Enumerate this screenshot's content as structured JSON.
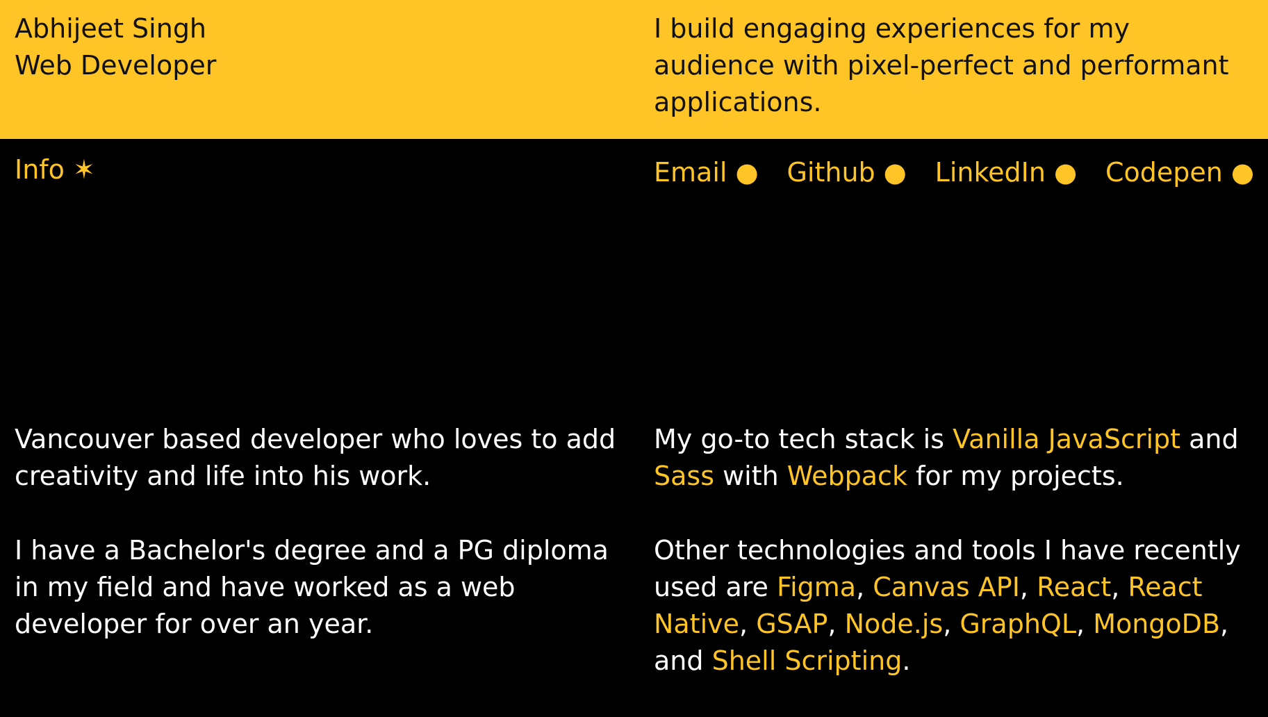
{
  "colors": {
    "accent": "#ffc425",
    "background": "#000000",
    "header_text": "#111111",
    "text": "#ffffff"
  },
  "header": {
    "name": "Abhijeet Singh",
    "role": "Web Developer",
    "tagline": "I build engaging experiences for my audience with pixel-perfect and performant applications."
  },
  "info": {
    "label": "Info",
    "icon": "six-pointed-star-icon",
    "glyph": "✶"
  },
  "social": [
    {
      "label": "Email",
      "bullet": "●"
    },
    {
      "label": "Github",
      "bullet": "●"
    },
    {
      "label": "LinkedIn",
      "bullet": "●"
    },
    {
      "label": "Codepen",
      "bullet": "●"
    }
  ],
  "about": {
    "p1": "Vancouver based developer who loves to add creativity and life into his work.",
    "p2": "I have a Bachelor's degree and a PG diploma in my field and have worked as a web developer for over an year."
  },
  "stack": {
    "intro": "My go-to tech stack is ",
    "t1": "Vanilla JavaScript",
    "and1": " and ",
    "t2": "Sass",
    "with": " with ",
    "t3": "Webpack",
    "end": " for my projects."
  },
  "other": {
    "intro": "Other technologies and tools I have recently used are ",
    "tools": [
      "Figma",
      "Canvas API",
      "React",
      "React Native",
      "GSAP",
      "Node.js",
      "GraphQL",
      "MongoDB"
    ],
    "comma": ", ",
    "comma_and": ", and ",
    "last": "Shell Scripting",
    "period": "."
  }
}
